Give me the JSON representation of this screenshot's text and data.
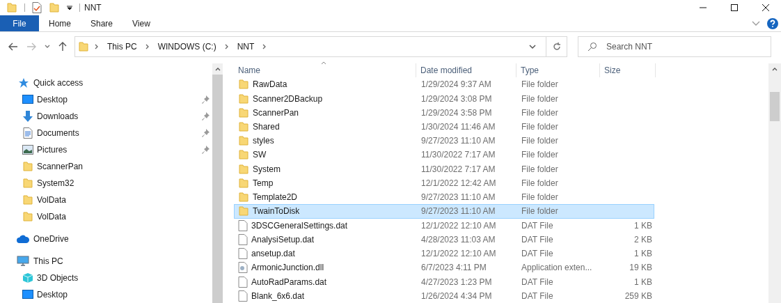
{
  "window": {
    "title": "NNT"
  },
  "ribbon": {
    "tabs": [
      {
        "label": "File",
        "kind": "file"
      },
      {
        "label": "Home",
        "kind": "tab"
      },
      {
        "label": "Share",
        "kind": "tab"
      },
      {
        "label": "View",
        "kind": "tab"
      }
    ]
  },
  "address_bar": {
    "crumbs": [
      "This PC",
      "WINDOWS (C:)",
      "NNT"
    ]
  },
  "search": {
    "placeholder": "Search NNT"
  },
  "sidebar": {
    "sections": [
      {
        "label": "Quick access",
        "kind": "star",
        "children": [
          {
            "label": "Desktop",
            "kind": "desktop",
            "pinned": true
          },
          {
            "label": "Downloads",
            "kind": "download",
            "pinned": true
          },
          {
            "label": "Documents",
            "kind": "document",
            "pinned": true
          },
          {
            "label": "Pictures",
            "kind": "pictures",
            "pinned": true
          },
          {
            "label": "ScannerPan",
            "kind": "folder",
            "pinned": false
          },
          {
            "label": "System32",
            "kind": "folder",
            "pinned": false
          },
          {
            "label": "VolData",
            "kind": "folder",
            "pinned": false
          },
          {
            "label": "VolData",
            "kind": "folder",
            "pinned": false
          }
        ]
      },
      {
        "label": "OneDrive",
        "kind": "cloud"
      },
      {
        "label": "This PC",
        "kind": "pc",
        "children": [
          {
            "label": "3D Objects",
            "kind": "cube",
            "pinned": false
          },
          {
            "label": "Desktop",
            "kind": "desktop",
            "pinned": false
          }
        ]
      }
    ]
  },
  "table": {
    "columns": [
      "Name",
      "Date modified",
      "Type",
      "Size"
    ],
    "rows": [
      {
        "name": "RawData",
        "date": "1/29/2024 9:37 AM",
        "type": "File folder",
        "kind": "folder",
        "selected": false
      },
      {
        "name": "Scanner2DBackup",
        "date": "1/29/2024 3:08 PM",
        "type": "File folder",
        "kind": "folder",
        "selected": false
      },
      {
        "name": "ScannerPan",
        "date": "1/29/2024 3:58 PM",
        "type": "File folder",
        "kind": "folder",
        "selected": false
      },
      {
        "name": "Shared",
        "date": "1/30/2024 11:46 AM",
        "type": "File folder",
        "kind": "folder",
        "selected": false
      },
      {
        "name": "styles",
        "date": "9/27/2023 11:10 AM",
        "type": "File folder",
        "kind": "folder",
        "selected": false
      },
      {
        "name": "SW",
        "date": "11/30/2022 7:17 AM",
        "type": "File folder",
        "kind": "folder",
        "selected": false
      },
      {
        "name": "System",
        "date": "11/30/2022 7:17 AM",
        "type": "File folder",
        "kind": "folder",
        "selected": false
      },
      {
        "name": "Temp",
        "date": "12/1/2022 12:42 AM",
        "type": "File folder",
        "kind": "folder",
        "selected": false
      },
      {
        "name": "Template2D",
        "date": "9/27/2023 11:10 AM",
        "type": "File folder",
        "kind": "folder",
        "selected": false
      },
      {
        "name": "TwainToDisk",
        "date": "9/27/2023 11:10 AM",
        "type": "File folder",
        "kind": "folder",
        "selected": true
      },
      {
        "name": "3DSCGeneralSettings.dat",
        "date": "12/1/2022 12:10 AM",
        "type": "DAT File",
        "size": "1 KB",
        "kind": "file",
        "selected": false
      },
      {
        "name": "AnalysiSetup.dat",
        "date": "4/28/2023 11:03 AM",
        "type": "DAT File",
        "size": "2 KB",
        "kind": "file",
        "selected": false
      },
      {
        "name": "ansetup.dat",
        "date": "12/1/2022 12:10 AM",
        "type": "DAT File",
        "size": "1 KB",
        "kind": "file",
        "selected": false
      },
      {
        "name": "ArmonicJunction.dll",
        "date": "6/7/2023 4:11 PM",
        "type": "Application exten...",
        "size": "19 KB",
        "kind": "dll",
        "selected": false
      },
      {
        "name": "AutoRadParams.dat",
        "date": "4/27/2023 1:23 PM",
        "type": "DAT File",
        "size": "1 KB",
        "kind": "file",
        "selected": false
      },
      {
        "name": "Blank_6x6.dat",
        "date": "1/26/2024 4:34 PM",
        "type": "DAT File",
        "size": "259 KB",
        "kind": "file",
        "selected": false
      }
    ]
  }
}
